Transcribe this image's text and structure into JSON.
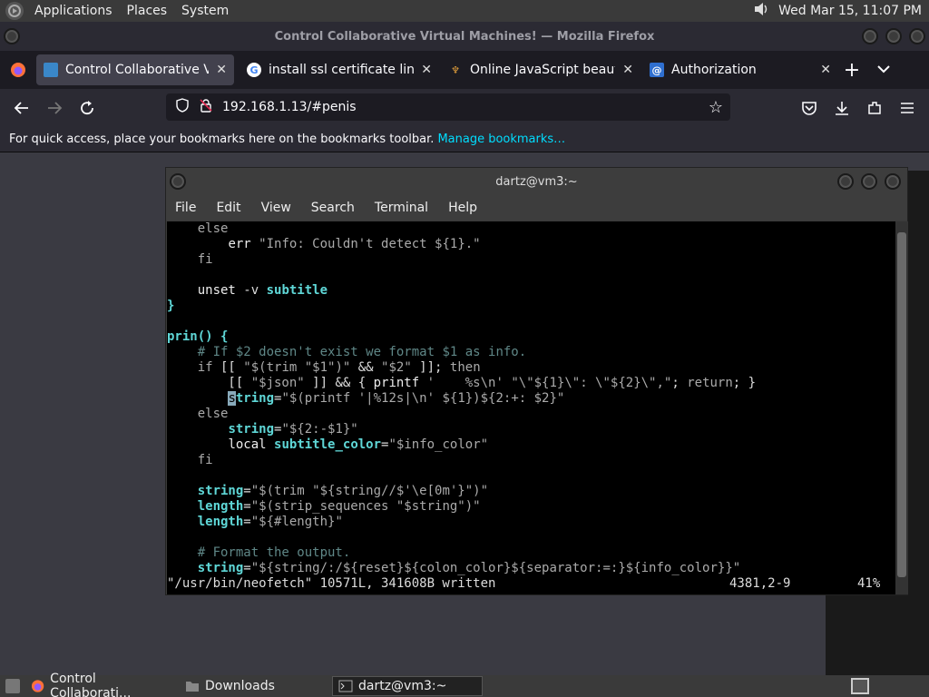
{
  "top_panel": {
    "menus": [
      "Applications",
      "Places",
      "System"
    ],
    "datetime": "Wed Mar 15, 11:07 PM"
  },
  "firefox": {
    "window_title": "Control Collaborative Virtual Machines! — Mozilla Firefox",
    "tabs": [
      {
        "label": "Control Collaborative Virtua",
        "active": true
      },
      {
        "label": "install ssl certificate linux - G",
        "active": false
      },
      {
        "label": "Online JavaScript beautifier",
        "active": false
      },
      {
        "label": "Authorization",
        "active": false
      }
    ],
    "url": "192.168.1.13/#penis",
    "bookmarks_hint": "For quick access, place your bookmarks here on the bookmarks toolbar.",
    "manage_bookmarks": "Manage bookmarks…"
  },
  "terminal": {
    "title": "dartz@vm3:~",
    "menu": [
      "File",
      "Edit",
      "View",
      "Search",
      "Terminal",
      "Help"
    ],
    "status_left": "\"/usr/bin/neofetch\" 10571L, 341608B written",
    "status_pos": "4381,2-9",
    "status_pct": "41%"
  },
  "taskbar": {
    "items": [
      "Control Collaborati...",
      "Downloads",
      "dartz@vm3:~"
    ]
  },
  "colors": {
    "accent_link": "#00ddff",
    "code_keyword": "#5fd7d7"
  }
}
